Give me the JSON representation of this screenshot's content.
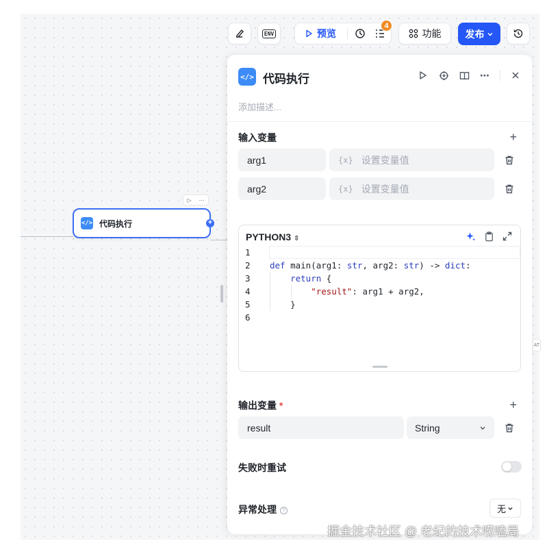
{
  "toolbar": {
    "preview_label": "预览",
    "badge_count": "4",
    "feature_label": "功能",
    "publish_label": "发布",
    "env_label": "ENV"
  },
  "canvas": {
    "node_title": "代码执行"
  },
  "panel": {
    "title": "代码执行",
    "description_placeholder": "添加描述...",
    "input_section": "输入变量",
    "inputs": [
      {
        "name": "arg1",
        "value_placeholder": "设置变量值"
      },
      {
        "name": "arg2",
        "value_placeholder": "设置变量值"
      }
    ],
    "xvar_symbol": "{x}",
    "code": {
      "language": "PYTHON3",
      "line_numbers": [
        "1",
        "2",
        "3",
        "4",
        "5",
        "6"
      ]
    },
    "output_section": "输出变量",
    "required_mark": "*",
    "outputs": [
      {
        "name": "result",
        "type": "String"
      }
    ],
    "retry_label": "失败时重试",
    "retry_enabled": false,
    "exception_label": "异常处理",
    "exception_value": "无"
  },
  "colors": {
    "primary": "#2457f5",
    "badge": "#f08a24",
    "node_icon": "#3d8bf6"
  },
  "watermark": "掘金技术社区 @ 老纪的技术唠嗑局"
}
